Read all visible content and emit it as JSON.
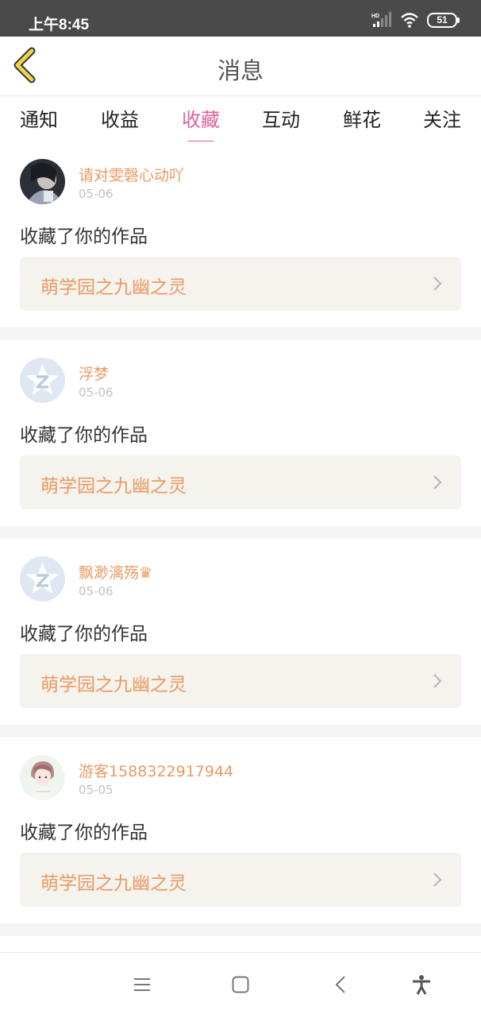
{
  "status_bar": {
    "time": "上午8:45",
    "battery": "51",
    "icons": [
      "hd-signal-icon",
      "wifi-icon",
      "battery-icon"
    ]
  },
  "header": {
    "title": "消息",
    "back_icon": "chevron-left-icon"
  },
  "tabs": [
    {
      "label": "通知",
      "active": false
    },
    {
      "label": "收益",
      "active": false
    },
    {
      "label": "收藏",
      "active": true
    },
    {
      "label": "互动",
      "active": false
    },
    {
      "label": "鲜花",
      "active": false
    },
    {
      "label": "关注",
      "active": false
    }
  ],
  "feed": [
    {
      "username": "请对雯磬心动吖",
      "date": "05-06",
      "action": "收藏了你的作品",
      "work_title": "萌学园之九幽之灵",
      "avatar": "photo-avatar"
    },
    {
      "username": "浮梦",
      "date": "05-06",
      "action": "收藏了你的作品",
      "work_title": "萌学园之九幽之灵",
      "avatar": "default-star-avatar"
    },
    {
      "username": "飘渺漓殇♛",
      "date": "05-06",
      "action": "收藏了你的作品",
      "work_title": "萌学园之九幽之灵",
      "avatar": "default-star-avatar"
    },
    {
      "username": "游客1588322917944",
      "date": "05-05",
      "action": "收藏了你的作品",
      "work_title": "萌学园之九幽之灵",
      "avatar": "anime-avatar"
    }
  ],
  "nav_bar": {
    "buttons": [
      "menu-icon",
      "home-icon",
      "back-icon",
      "accessibility-icon"
    ]
  },
  "colors": {
    "accent_pink": "#e0609a",
    "name_orange": "#ec9a63",
    "back_arrow_yellow": "#f0d34a",
    "card_bg": "#f4f3ee"
  }
}
